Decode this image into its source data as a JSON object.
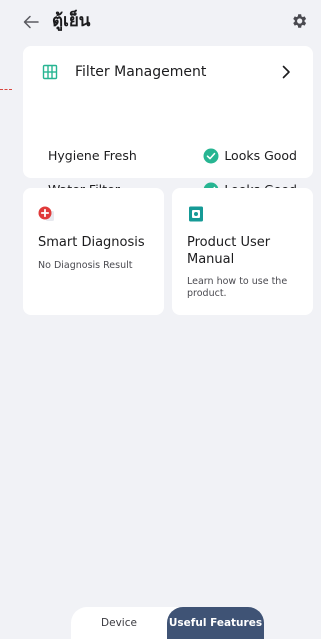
{
  "header": {
    "title": "ตู้เย็น"
  },
  "filter_card": {
    "title": "Filter Management",
    "rows": [
      {
        "label": "Hygiene Fresh",
        "status": "Looks Good"
      },
      {
        "label": "Water Filter",
        "status": "Looks Good"
      }
    ]
  },
  "features": {
    "diagnosis": {
      "title": "Smart Diagnosis",
      "desc": "No Diagnosis Result"
    },
    "manual": {
      "title": "Product User Manual",
      "desc": "Learn how to use the product."
    }
  },
  "tabs": {
    "device": "Device",
    "useful": "Useful Features"
  },
  "colors": {
    "background": "#f1f2f6",
    "card": "#ffffff",
    "accent_green": "#27b592",
    "teal": "#159a96",
    "red": "#e03a3a",
    "tab_active": "#3f5375"
  },
  "icons": {
    "back": "arrow-left-icon",
    "settings": "gear-icon",
    "filter": "grid-icon",
    "chevron": "chevron-right-icon",
    "status": "check-circle-icon",
    "diagnosis": "diagnosis-icon",
    "manual": "manual-icon"
  }
}
